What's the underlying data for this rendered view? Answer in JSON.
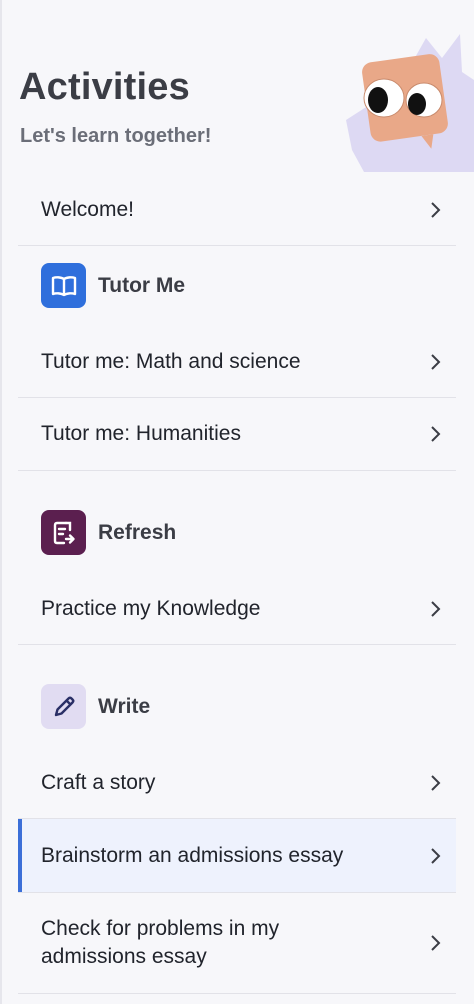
{
  "header": {
    "title": "Activities",
    "subtitle": "Let's learn together!"
  },
  "items": {
    "welcome": "Welcome!",
    "tutor_math": "Tutor me: Math and science",
    "tutor_humanities": "Tutor me: Humanities",
    "practice": "Practice my Knowledge",
    "craft_story": "Craft a story",
    "brainstorm": "Brainstorm an admissions essay",
    "check_problems": "Check for problems in my admissions essay"
  },
  "sections": {
    "tutor": "Tutor Me",
    "refresh": "Refresh",
    "write": "Write"
  },
  "colors": {
    "tutor_badge": "#2f6fdc",
    "refresh_badge": "#5b1f4f",
    "write_badge": "#e1dcf2",
    "selected_accent": "#3b6fd8"
  },
  "icons": {
    "chevron": "chevron-right-icon",
    "tutor": "book-icon",
    "refresh": "document-arrow-icon",
    "write": "pencil-icon",
    "mascot": "mascot-face-icon"
  }
}
